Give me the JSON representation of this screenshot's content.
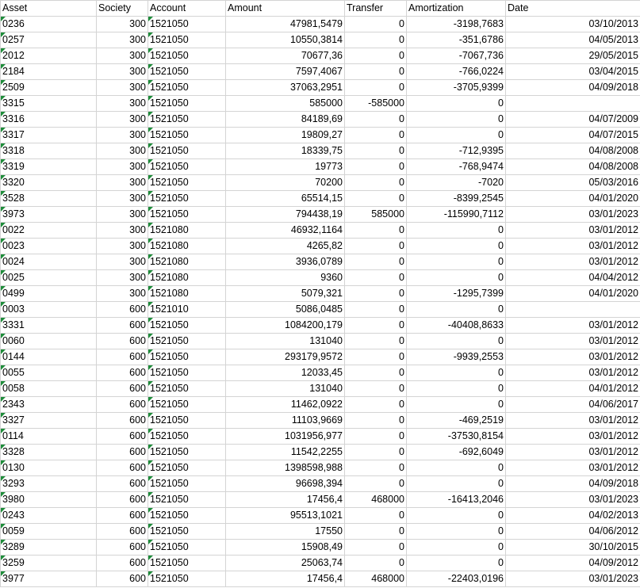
{
  "sheet": {
    "headers": [
      "Asset",
      "Society",
      "Account",
      "Amount",
      "Transfer",
      "Amortization",
      "Date"
    ],
    "indicator_color": "#1e8c3a",
    "rows": [
      [
        "0236",
        "300",
        "1521050",
        "47981,5479",
        "0",
        "-3198,7683",
        "03/10/2013"
      ],
      [
        "0257",
        "300",
        "1521050",
        "10550,3814",
        "0",
        "-351,6786",
        "04/05/2013"
      ],
      [
        "2012",
        "300",
        "1521050",
        "70677,36",
        "0",
        "-7067,736",
        "29/05/2015"
      ],
      [
        "2184",
        "300",
        "1521050",
        "7597,4067",
        "0",
        "-766,0224",
        "03/04/2015"
      ],
      [
        "2509",
        "300",
        "1521050",
        "37063,2951",
        "0",
        "-3705,9399",
        "04/09/2018"
      ],
      [
        "3315",
        "300",
        "1521050",
        "585000",
        "-585000",
        "0",
        ""
      ],
      [
        "3316",
        "300",
        "1521050",
        "84189,69",
        "0",
        "0",
        "04/07/2009"
      ],
      [
        "3317",
        "300",
        "1521050",
        "19809,27",
        "0",
        "0",
        "04/07/2015"
      ],
      [
        "3318",
        "300",
        "1521050",
        "18339,75",
        "0",
        "-712,9395",
        "04/08/2008"
      ],
      [
        "3319",
        "300",
        "1521050",
        "19773",
        "0",
        "-768,9474",
        "04/08/2008"
      ],
      [
        "3320",
        "300",
        "1521050",
        "70200",
        "0",
        "-7020",
        "05/03/2016"
      ],
      [
        "3528",
        "300",
        "1521050",
        "65514,15",
        "0",
        "-8399,2545",
        "04/01/2020"
      ],
      [
        "3973",
        "300",
        "1521050",
        "794438,19",
        "585000",
        "-115990,7112",
        "03/01/2023"
      ],
      [
        "0022",
        "300",
        "1521080",
        "46932,1164",
        "0",
        "0",
        "03/01/2012"
      ],
      [
        "0023",
        "300",
        "1521080",
        "4265,82",
        "0",
        "0",
        "03/01/2012"
      ],
      [
        "0024",
        "300",
        "1521080",
        "3936,0789",
        "0",
        "0",
        "03/01/2012"
      ],
      [
        "0025",
        "300",
        "1521080",
        "9360",
        "0",
        "0",
        "04/04/2012"
      ],
      [
        "0499",
        "300",
        "1521080",
        "5079,321",
        "0",
        "-1295,7399",
        "04/01/2020"
      ],
      [
        "0003",
        "600",
        "1521010",
        "5086,0485",
        "0",
        "0",
        ""
      ],
      [
        "3331",
        "600",
        "1521050",
        "1084200,179",
        "0",
        "-40408,8633",
        "03/01/2012"
      ],
      [
        "0060",
        "600",
        "1521050",
        "131040",
        "0",
        "0",
        "03/01/2012"
      ],
      [
        "0144",
        "600",
        "1521050",
        "293179,9572",
        "0",
        "-9939,2553",
        "03/01/2012"
      ],
      [
        "0055",
        "600",
        "1521050",
        "12033,45",
        "0",
        "0",
        "03/01/2012"
      ],
      [
        "0058",
        "600",
        "1521050",
        "131040",
        "0",
        "0",
        "04/01/2012"
      ],
      [
        "2343",
        "600",
        "1521050",
        "11462,0922",
        "0",
        "0",
        "04/06/2017"
      ],
      [
        "3327",
        "600",
        "1521050",
        "11103,9669",
        "0",
        "-469,2519",
        "03/01/2012"
      ],
      [
        "0114",
        "600",
        "1521050",
        "1031956,977",
        "0",
        "-37530,8154",
        "03/01/2012"
      ],
      [
        "3328",
        "600",
        "1521050",
        "11542,2255",
        "0",
        "-692,6049",
        "03/01/2012"
      ],
      [
        "0130",
        "600",
        "1521050",
        "1398598,988",
        "0",
        "0",
        "03/01/2012"
      ],
      [
        "3293",
        "600",
        "1521050",
        "96698,394",
        "0",
        "0",
        "04/09/2018"
      ],
      [
        "3980",
        "600",
        "1521050",
        "17456,4",
        "468000",
        "-16413,2046",
        "03/01/2023"
      ],
      [
        "0243",
        "600",
        "1521050",
        "95513,1021",
        "0",
        "0",
        "04/02/2013"
      ],
      [
        "0059",
        "600",
        "1521050",
        "17550",
        "0",
        "0",
        "04/06/2012"
      ],
      [
        "3289",
        "600",
        "1521050",
        "15908,49",
        "0",
        "0",
        "30/10/2015"
      ],
      [
        "3259",
        "600",
        "1521050",
        "25063,74",
        "0",
        "0",
        "04/09/2012"
      ],
      [
        "3977",
        "600",
        "1521050",
        "17456,4",
        "468000",
        "-22403,0196",
        "03/01/2023"
      ]
    ]
  }
}
